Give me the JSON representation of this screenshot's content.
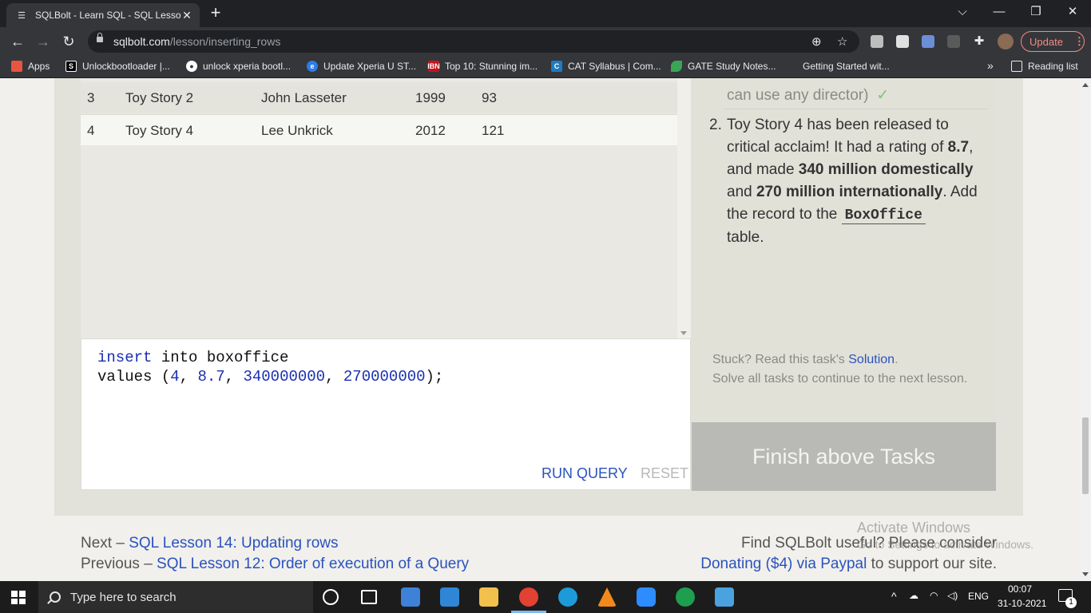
{
  "browser": {
    "tab_title": "SQLBolt - Learn SQL - SQL Lesson",
    "tab_close": "✕",
    "new_tab": "+",
    "window_controls": {
      "chevron": "⌵",
      "minimize": "—",
      "restore": "❐",
      "close": "✕"
    },
    "url_domain": "sqlbolt.com",
    "url_path": "/lesson/inserting_rows",
    "update_label": "Update",
    "update_menu": "⋮",
    "bookmarks": [
      {
        "label": "Apps",
        "icon": "apps-grid-icon",
        "color": "#e8543f"
      },
      {
        "label": "Unlockbootloader |...",
        "icon": "s-logo-icon",
        "color": "#000000"
      },
      {
        "label": "unlock xperia bootl...",
        "icon": "globe-icon",
        "color": "#ffffff"
      },
      {
        "label": "Update Xperia U ST...",
        "icon": "edge-icon",
        "color": "#2b7de9"
      },
      {
        "label": "Top 10: Stunning im...",
        "icon": "ibn-icon",
        "color": "#c4161c"
      },
      {
        "label": "CAT Syllabus | Com...",
        "icon": "c-logo-icon",
        "color": "#1f7bc1"
      },
      {
        "label": "GATE Study Notes...",
        "icon": "leaf-icon",
        "color": "#3aa655"
      },
      {
        "label": "Getting Started wit...",
        "icon": "blank-page-icon",
        "color": "#35363a"
      }
    ],
    "more_bookmarks": "»",
    "reading_list": "Reading list"
  },
  "results": {
    "rows": [
      {
        "id": "3",
        "title": "Toy Story 2",
        "director": "John Lasseter",
        "year": "1999",
        "length": "93"
      },
      {
        "id": "4",
        "title": "Toy Story 4",
        "director": "Lee Unkrick",
        "year": "2012",
        "length": "121"
      }
    ]
  },
  "editor": {
    "line1_kw": "insert",
    "line1_rest": " into boxoffice",
    "line2_start": "values (",
    "v1": "4",
    "v2": "8.7",
    "v3": "340000000",
    "v4": "270000000",
    "sep": ", ",
    "line2_end": ");",
    "run_label": "RUN QUERY",
    "reset_label": "RESET"
  },
  "tasks": {
    "task1_tail": "can use any director)",
    "task1_check": "✓",
    "task2_number": "2.",
    "task2_part1": "Toy Story 4 has been released to critical acclaim! It had a rating of ",
    "task2_rating": "8.7",
    "task2_part2": ", and made ",
    "task2_domestic": "340 million domestically",
    "task2_part3": " and ",
    "task2_intl": "270 million internationally",
    "task2_part4": ". Add the record to the ",
    "task2_table": "BoxOffice",
    "task2_part5": " table.",
    "stuck_prefix": "Stuck? Read this task's ",
    "stuck_link": "Solution",
    "stuck_suffix": ".",
    "stuck_line2": "Solve all tasks to continue to the next lesson.",
    "finish_label": "Finish above Tasks"
  },
  "footer": {
    "next_prefix": "Next – ",
    "next_link": "SQL Lesson 14: Updating rows",
    "prev_prefix": "Previous – ",
    "prev_link": "SQL Lesson 12: Order of execution of a Query",
    "support_line1": "Find SQLBolt useful? Please consider",
    "support_link": "Donating ($4) via Paypal",
    "support_suffix": " to support our site."
  },
  "watermark": {
    "line1": "Activate Windows",
    "line2": "Go to Settings to activate Windows."
  },
  "taskbar": {
    "search_placeholder": "Type here to search",
    "language": "ENG",
    "time": "00:07",
    "date": "31-10-2021",
    "notification_count": "1"
  }
}
